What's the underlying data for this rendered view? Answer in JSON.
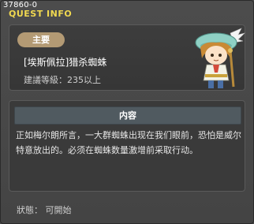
{
  "quest_id": "37860-0",
  "window_title": "QUEST INFO",
  "quest": {
    "badge": "主要",
    "name": "[埃斯佩拉]猎杀蜘蛛",
    "level": "建議等級：235以上"
  },
  "content": {
    "header": "内容",
    "text": "正如梅尔朗所言，一大群蜘蛛出现在我们眼前，恐怕是威尔特意放出的。必须在蜘蛛数量激增前采取行动。"
  },
  "status": "狀態： 可開始"
}
